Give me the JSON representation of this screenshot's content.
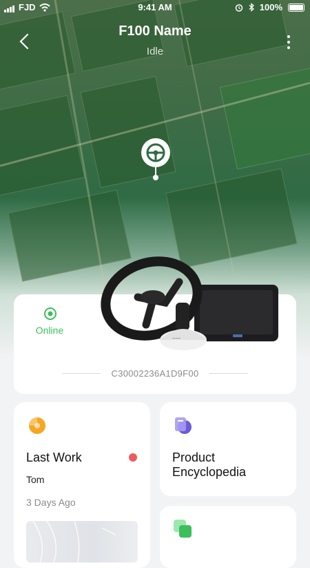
{
  "status_bar": {
    "carrier": "FJD",
    "time": "9:41 AM",
    "battery": "100%"
  },
  "header": {
    "title": "F100 Name",
    "subtitle": "Idle"
  },
  "device_card": {
    "status": "Online",
    "serial": "C30002236A1D9F00"
  },
  "last_work": {
    "title": "Last Work",
    "user": "Tom",
    "time_ago": "3 Days Ago"
  },
  "encyclopedia": {
    "title": "Product Encyclopedia"
  },
  "colors": {
    "online": "#3cbf5b",
    "alert": "#f05a5a",
    "map_green": "#2f6b45"
  },
  "icons": [
    "signal-icon",
    "wifi-icon",
    "alarm-icon",
    "bluetooth-icon",
    "battery-icon",
    "back-icon",
    "more-icon",
    "steering-pin-icon",
    "online-icon",
    "last-work-icon",
    "encyclopedia-icon",
    "tile-icon"
  ]
}
